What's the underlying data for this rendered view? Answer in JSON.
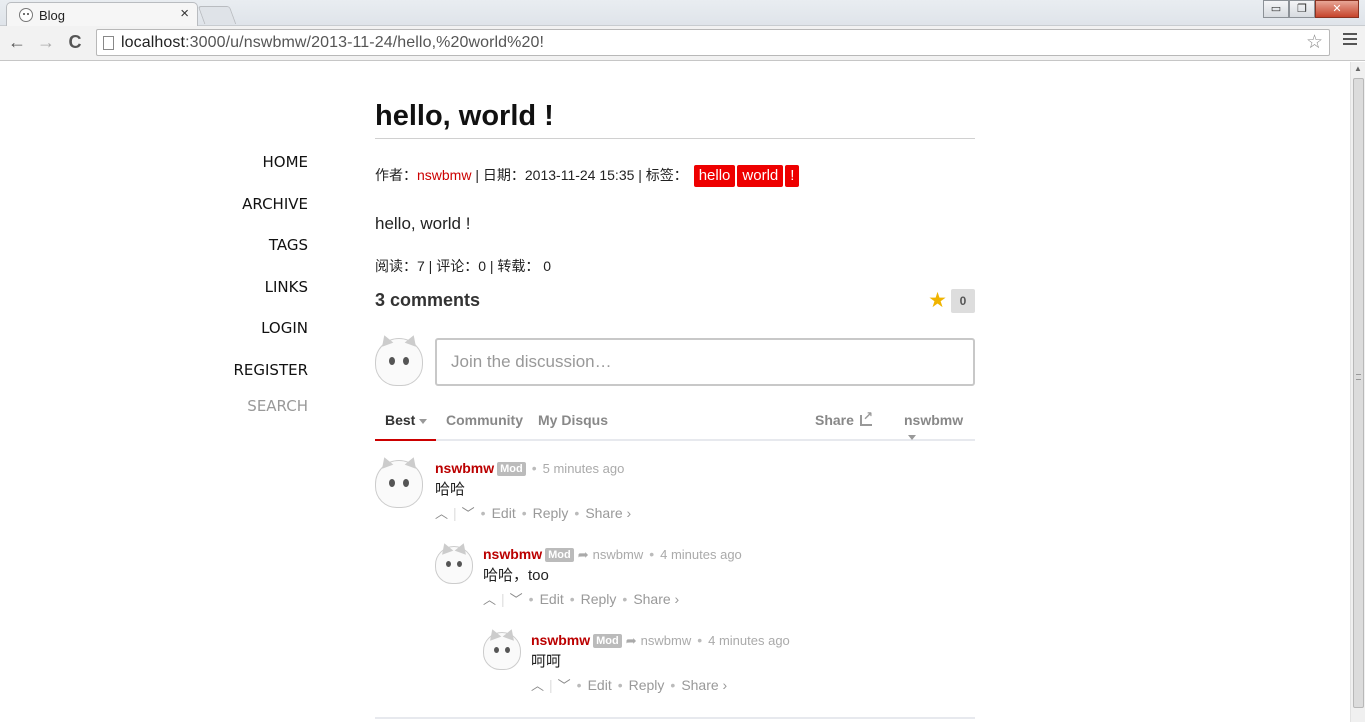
{
  "browser": {
    "tab_title": "Blog",
    "tab_close": "×",
    "url_host": "localhost",
    "url_path": ":3000/u/nswbmw/2013-11-24/hello,%20world%20!",
    "back": "←",
    "forward": "→",
    "reload": "C",
    "window_minimize": "▭",
    "window_restore": "❐",
    "window_close": "✕"
  },
  "sidebar": {
    "items": [
      {
        "label": "HOME"
      },
      {
        "label": "ARCHIVE"
      },
      {
        "label": "TAGS"
      },
      {
        "label": "LINKS"
      },
      {
        "label": "LOGIN"
      },
      {
        "label": "REGISTER"
      },
      {
        "label": "SEARCH"
      }
    ]
  },
  "post": {
    "title": "hello, world !",
    "meta_author_label": "作者：",
    "author": "nswbmw",
    "meta_date_label": " | 日期：",
    "date": "2013-11-24 15:35",
    "meta_tags_label": " | 标签：",
    "tags": [
      "hello",
      "world",
      "!"
    ],
    "body": "hello, world !",
    "stats": "阅读：7 | 评论：0 | 转载： 0"
  },
  "disqus": {
    "comments_count": "3 comments",
    "recommend_count": "0",
    "input_placeholder": "Join the discussion…",
    "tabs": {
      "best": "Best",
      "community": "Community",
      "my_disqus": "My Disqus",
      "share": "Share",
      "user": "nswbmw"
    },
    "comments": [
      {
        "author": "nswbmw",
        "badge": "Mod",
        "reply_to": "",
        "time": "5 minutes ago",
        "text": "哈哈",
        "actions": {
          "edit": "Edit",
          "reply": "Reply",
          "share": "Share ›"
        }
      },
      {
        "author": "nswbmw",
        "badge": "Mod",
        "reply_to": "nswbmw",
        "time": "4 minutes ago",
        "text": "哈哈，too",
        "actions": {
          "edit": "Edit",
          "reply": "Reply",
          "share": "Share ›"
        }
      },
      {
        "author": "nswbmw",
        "badge": "Mod",
        "reply_to": "nswbmw",
        "time": "4 minutes ago",
        "text": "呵呵",
        "actions": {
          "edit": "Edit",
          "reply": "Reply",
          "share": "Share ›"
        }
      }
    ]
  }
}
